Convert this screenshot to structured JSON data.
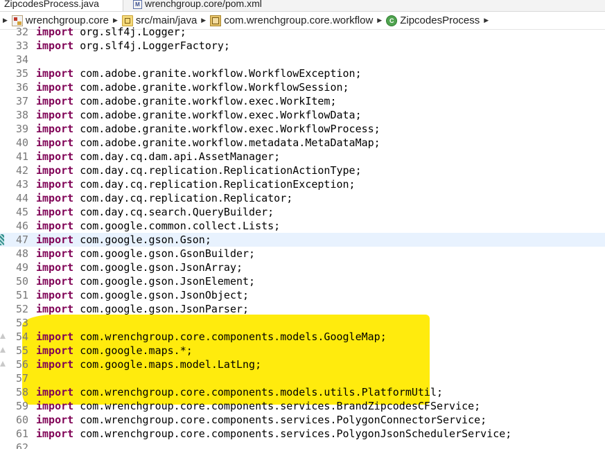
{
  "tabs": [
    {
      "label": "ZipcodesProcess.java",
      "active": true
    },
    {
      "label": "wrenchgroup.core/pom.xml",
      "active": false,
      "icon": "xml-file-icon",
      "icon_text": "M"
    }
  ],
  "breadcrumb": [
    {
      "label": "wrenchgroup.core",
      "icon": "project-icon"
    },
    {
      "label": "src/main/java",
      "icon": "source-folder-icon"
    },
    {
      "label": "com.wrenchgroup.core.workflow",
      "icon": "package-icon"
    },
    {
      "label": "ZipcodesProcess",
      "icon": "class-icon"
    }
  ],
  "colors": {
    "keyword": "#7f0055",
    "line_number": "#787878",
    "current_line": "#e8f2fe",
    "highlight": "#ffea00"
  },
  "editor": {
    "current_line_number": "47",
    "highlighted_lines": [
      "53",
      "54",
      "55",
      "56"
    ],
    "lines": [
      {
        "n": "32",
        "kw": "import",
        "text": " org.slf4j.Logger;"
      },
      {
        "n": "33",
        "kw": "import",
        "text": " org.slf4j.LoggerFactory;"
      },
      {
        "n": "34",
        "kw": "",
        "text": ""
      },
      {
        "n": "35",
        "kw": "import",
        "text": " com.adobe.granite.workflow.WorkflowException;"
      },
      {
        "n": "36",
        "kw": "import",
        "text": " com.adobe.granite.workflow.WorkflowSession;"
      },
      {
        "n": "37",
        "kw": "import",
        "text": " com.adobe.granite.workflow.exec.WorkItem;"
      },
      {
        "n": "38",
        "kw": "import",
        "text": " com.adobe.granite.workflow.exec.WorkflowData;"
      },
      {
        "n": "39",
        "kw": "import",
        "text": " com.adobe.granite.workflow.exec.WorkflowProcess;"
      },
      {
        "n": "40",
        "kw": "import",
        "text": " com.adobe.granite.workflow.metadata.MetaDataMap;"
      },
      {
        "n": "41",
        "kw": "import",
        "text": " com.day.cq.dam.api.AssetManager;"
      },
      {
        "n": "42",
        "kw": "import",
        "text": " com.day.cq.replication.ReplicationActionType;"
      },
      {
        "n": "43",
        "kw": "import",
        "text": " com.day.cq.replication.ReplicationException;"
      },
      {
        "n": "44",
        "kw": "import",
        "text": " com.day.cq.replication.Replicator;"
      },
      {
        "n": "45",
        "kw": "import",
        "text": " com.day.cq.search.QueryBuilder;"
      },
      {
        "n": "46",
        "kw": "import",
        "text": " com.google.common.collect.Lists;"
      },
      {
        "n": "47",
        "kw": "import",
        "text": " com.google.gson.Gson;"
      },
      {
        "n": "48",
        "kw": "import",
        "text": " com.google.gson.GsonBuilder;"
      },
      {
        "n": "49",
        "kw": "import",
        "text": " com.google.gson.JsonArray;"
      },
      {
        "n": "50",
        "kw": "import",
        "text": " com.google.gson.JsonElement;"
      },
      {
        "n": "51",
        "kw": "import",
        "text": " com.google.gson.JsonObject;"
      },
      {
        "n": "52",
        "kw": "import",
        "text": " com.google.gson.JsonParser;"
      },
      {
        "n": "53",
        "kw": "",
        "text": ""
      },
      {
        "n": "54",
        "kw": "import",
        "text": " com.wrenchgroup.core.components.models.GoogleMap;",
        "warning": true
      },
      {
        "n": "55",
        "kw": "import",
        "text": " com.google.maps.*;",
        "warning": true
      },
      {
        "n": "56",
        "kw": "import",
        "text": " com.google.maps.model.LatLng;",
        "warning": true
      },
      {
        "n": "57",
        "kw": "",
        "text": ""
      },
      {
        "n": "58",
        "kw": "import",
        "text": " com.wrenchgroup.core.components.models.utils.PlatformUtil;"
      },
      {
        "n": "59",
        "kw": "import",
        "text": " com.wrenchgroup.core.components.services.BrandZipcodesCFService;"
      },
      {
        "n": "60",
        "kw": "import",
        "text": " com.wrenchgroup.core.components.services.PolygonConnectorService;"
      },
      {
        "n": "61",
        "kw": "import",
        "text": " com.wrenchgroup.core.components.services.PolygonJsonSchedulerService;"
      },
      {
        "n": "62",
        "kw": "",
        "text": ""
      }
    ]
  }
}
